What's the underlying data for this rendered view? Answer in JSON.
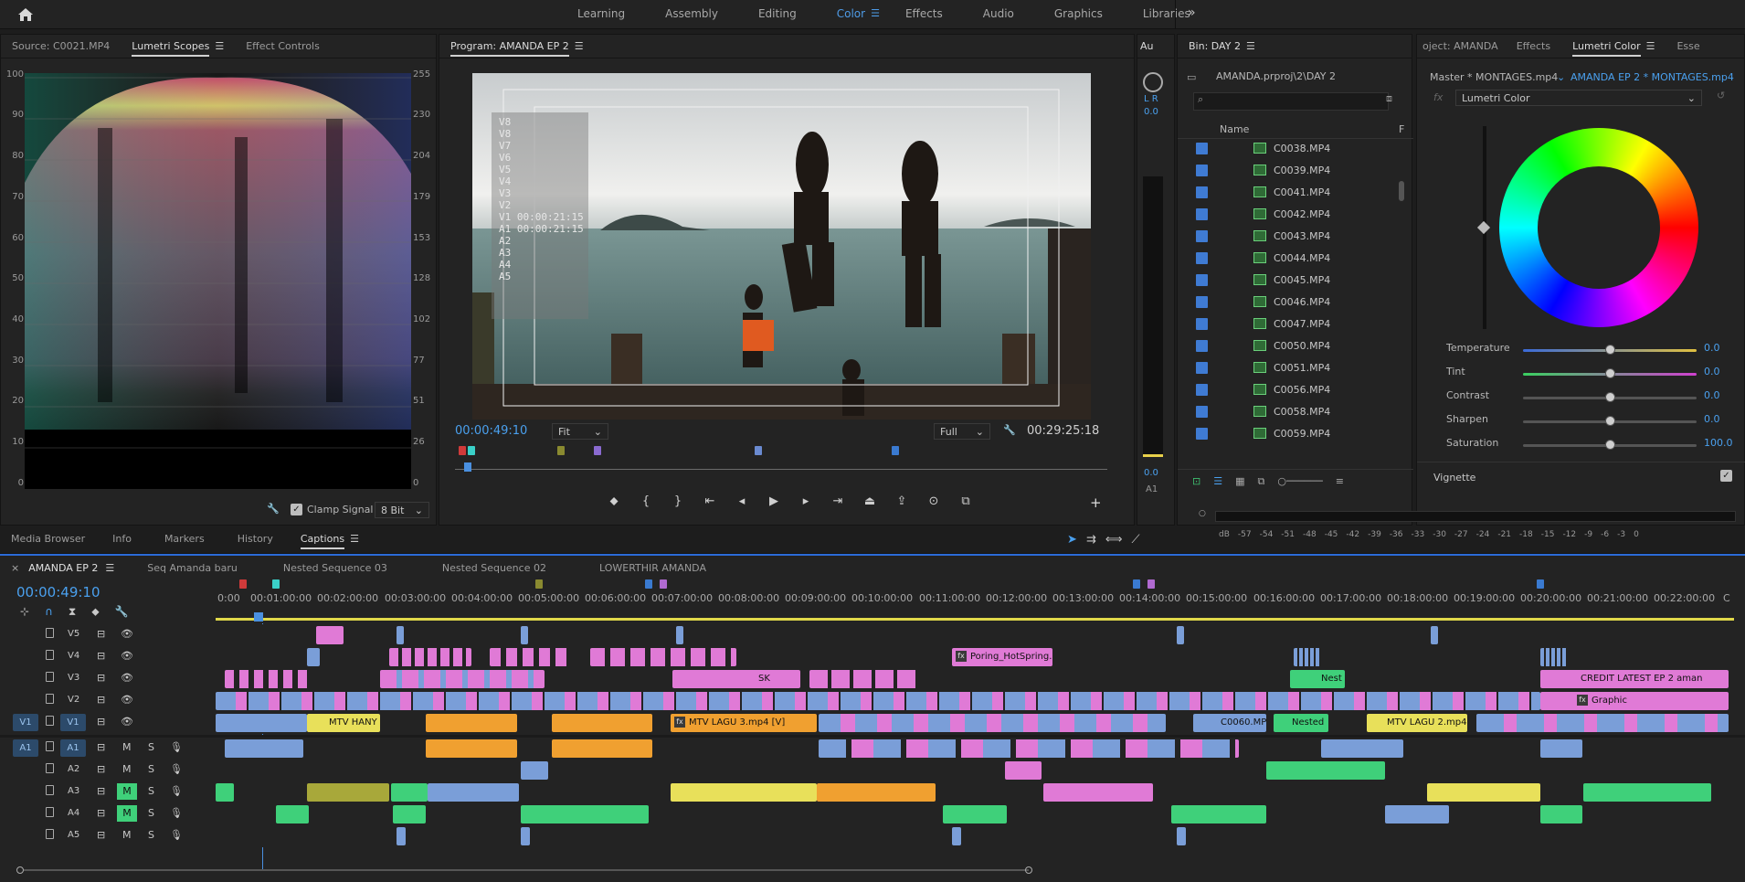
{
  "workspaces": [
    "Learning",
    "Assembly",
    "Editing",
    "Color",
    "Effects",
    "Audio",
    "Graphics",
    "Libraries"
  ],
  "active_workspace": "Color",
  "scopes": {
    "tabs": [
      "Source: C0021.MP4",
      "Lumetri Scopes",
      "Effect Controls"
    ],
    "left_scale": [
      "100",
      "90",
      "80",
      "70",
      "60",
      "50",
      "40",
      "30",
      "20",
      "10",
      "0"
    ],
    "right_scale": [
      "255",
      "230",
      "204",
      "179",
      "153",
      "128",
      "102",
      "77",
      "51",
      "26",
      "0"
    ],
    "clamp_label": "Clamp Signal",
    "bit_depth": "8 Bit"
  },
  "program": {
    "title": "Program: AMANDA EP 2",
    "overlay_lines": [
      "V8",
      "V8",
      "V7",
      "V6",
      "V5",
      "V4",
      "V3",
      "V2",
      "V1 00:00:21:15",
      "A1 00:00:21:15",
      "A2",
      "A3",
      "A4",
      "A5"
    ],
    "current_tc": "00:00:49:10",
    "fit": "Fit",
    "quality": "Full",
    "duration_tc": "00:29:25:18"
  },
  "audio_meter": {
    "tab": "Au",
    "lr": "L R",
    "val": "0.0",
    "bottom_val": "0.0",
    "channel": "A1"
  },
  "bin": {
    "title": "Bin: DAY 2",
    "path": "AMANDA.prproj\\2\\DAY 2",
    "col_name": "Name",
    "col_f": "F",
    "files": [
      "C0038.MP4",
      "C0039.MP4",
      "C0041.MP4",
      "C0042.MP4",
      "C0043.MP4",
      "C0044.MP4",
      "C0045.MP4",
      "C0046.MP4",
      "C0047.MP4",
      "C0050.MP4",
      "C0051.MP4",
      "C0056.MP4",
      "C0058.MP4",
      "C0059.MP4"
    ]
  },
  "lumetri": {
    "tabs": [
      "oject: AMANDA",
      "Effects",
      "Lumetri Color",
      "Esse"
    ],
    "master": "Master * MONTAGES.mp4",
    "sequence": "AMANDA EP 2 * MONTAGES.mp4",
    "fx_name": "Lumetri Color",
    "sliders": [
      {
        "label": "Temperature",
        "value": "0.0",
        "pos": 0.5
      },
      {
        "label": "Tint",
        "value": "0.0",
        "pos": 0.5
      },
      {
        "label": "Contrast",
        "value": "0.0",
        "pos": 0.5
      },
      {
        "label": "Sharpen",
        "value": "0.0",
        "pos": 0.5
      },
      {
        "label": "Saturation",
        "value": "100.0",
        "pos": 0.5
      }
    ],
    "vignette": "Vignette"
  },
  "lower_tabs": [
    "Media Browser",
    "Info",
    "Markers",
    "History",
    "Captions"
  ],
  "audio_scale": [
    "dB",
    "-57",
    "-54",
    "-51",
    "-48",
    "-45",
    "-42",
    "-39",
    "-36",
    "-33",
    "-30",
    "-27",
    "-24",
    "-21",
    "-18",
    "-15",
    "-12",
    "-9",
    "-6",
    "-3",
    "0"
  ],
  "timeline": {
    "seq_tabs": [
      "AMANDA EP 2",
      "Seq Amanda baru",
      "Nested Sequence 03",
      "Nested Sequence 02",
      "LOWERTHIR AMANDA"
    ],
    "timecode": "00:00:49:10",
    "ruler": [
      "0:00",
      "00:01:00:00",
      "00:02:00:00",
      "00:03:00:00",
      "00:04:00:00",
      "00:05:00:00",
      "00:06:00:00",
      "00:07:00:00",
      "00:08:00:00",
      "00:09:00:00",
      "00:10:00:00",
      "00:11:00:00",
      "00:12:00:00",
      "00:13:00:00",
      "00:14:00:00",
      "00:15:00:00",
      "00:16:00:00",
      "00:17:00:00",
      "00:18:00:00",
      "00:19:00:00",
      "00:20:00:00",
      "00:21:00:00",
      "00:22:00:00",
      "C"
    ],
    "video_tracks": [
      "V5",
      "V4",
      "V3",
      "V2",
      "V1"
    ],
    "audio_tracks": [
      "A1",
      "A2",
      "A3",
      "A4",
      "A5"
    ],
    "src_v": "V1",
    "src_a": "A1",
    "clip_labels": {
      "v4_a": "Poring_HotSpring.",
      "v3_a": "SK",
      "v3_b": "Nest",
      "v3_c": "CREDIT LATEST EP 2 aman",
      "v2_a": "Graphic",
      "v1_a": "MTV HANY",
      "v1_b": "MTV LAGU 3.mp4 [V]",
      "v1_c": "C0060.MP",
      "v1_d": "Nested",
      "v1_e": "MTV LAGU 2.mp4"
    }
  },
  "colors": {
    "accent": "#4e9be6",
    "pink": "#e07ad6",
    "blue": "#7a9ed8",
    "orange": "#f0a030",
    "yellow": "#e8e05a",
    "green": "#3fd07a"
  }
}
